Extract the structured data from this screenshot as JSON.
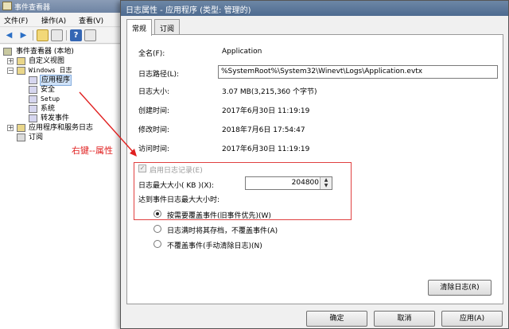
{
  "event_viewer": {
    "title": "事件查看器",
    "menu": [
      "文件(F)",
      "操作(A)",
      "查看(V)"
    ],
    "tree": {
      "root": "事件查看器 (本地)",
      "custom_views": "自定义视图",
      "windows_logs": "Windows 日志",
      "logs": [
        "应用程序",
        "安全",
        "Setup",
        "系统",
        "转发事件"
      ],
      "app_service_logs": "应用程序和服务日志",
      "subscriptions": "订阅"
    }
  },
  "annotation": {
    "text": "右键--属性",
    "color": "#e02020"
  },
  "dialog": {
    "title": "日志属性 - 应用程序 (类型: 管理的)",
    "tabs": [
      "常规",
      "订阅"
    ],
    "active_tab": "常规",
    "fields": {
      "full_name_label": "全名(F):",
      "full_name_value": "Application",
      "log_path_label": "日志路径(L):",
      "log_path_value": "%SystemRoot%\\System32\\Winevt\\Logs\\Application.evtx",
      "log_size_label": "日志大小:",
      "log_size_value": "3.07 MB(3,215,360 个字节)",
      "created_label": "创建时间:",
      "created_value": "2017年6月30日 11:19:19",
      "modified_label": "修改时间:",
      "modified_value": "2018年7月6日 17:54:47",
      "accessed_label": "访问时间:",
      "accessed_value": "2017年6月30日 11:19:19"
    },
    "enable_logging_label": "启用日志记录(E)",
    "enable_logging_checked": true,
    "max_size_label": "日志最大大小( KB )(X):",
    "max_size_value": "204800",
    "on_max_label": "达到事件日志最大大小时:",
    "retention_options": [
      "按需要覆盖事件(旧事件优先)(W)",
      "日志满时将其存档，不覆盖事件(A)",
      "不覆盖事件(手动清除日志)(N)"
    ],
    "selected_option": 0,
    "clear_log_button": "清除日志(R)",
    "buttons": {
      "ok": "确定",
      "cancel": "取消",
      "apply": "应用(A)"
    },
    "highlight_color": "#e04040"
  }
}
